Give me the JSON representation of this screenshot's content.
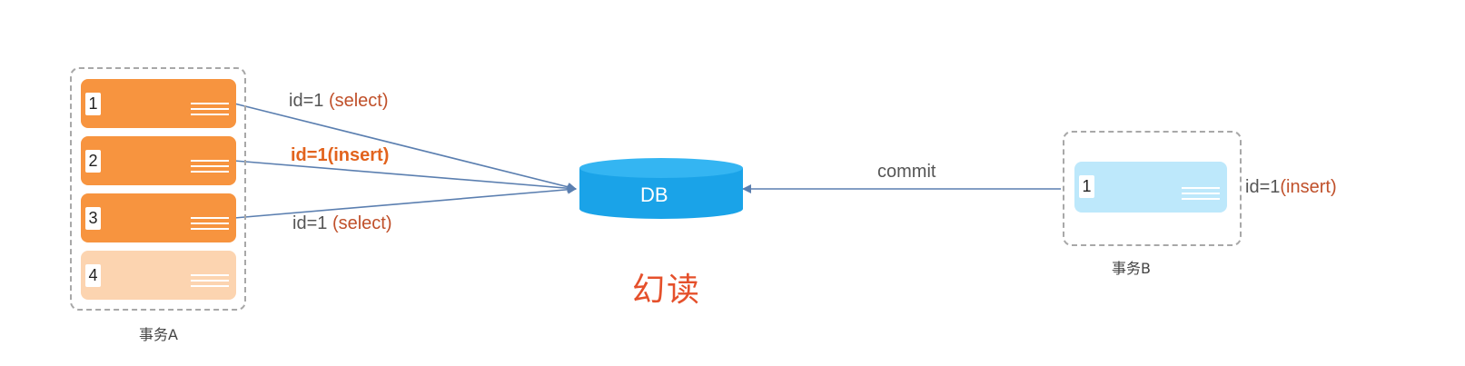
{
  "transaction_a": {
    "label": "事务A",
    "rows": [
      {
        "number": "1",
        "state": "normal"
      },
      {
        "number": "2",
        "state": "normal"
      },
      {
        "number": "3",
        "state": "normal"
      },
      {
        "number": "4",
        "state": "faded"
      }
    ]
  },
  "transaction_b": {
    "label": "事务B",
    "rows": [
      {
        "number": "1",
        "state": "normal"
      }
    ]
  },
  "edges": {
    "row1": {
      "key": "id=1 ",
      "op": "(select)"
    },
    "row2": {
      "key": "id=1",
      "op": "(insert)"
    },
    "row3": {
      "key": "id=1 ",
      "op": "(select)"
    },
    "commit": "commit"
  },
  "side_label": {
    "key": "id=1",
    "op": "(insert)"
  },
  "database": {
    "label": "DB"
  },
  "caption": "幻读",
  "colors": {
    "row_orange": "#f7943f",
    "row_faded": "#fcd4b0",
    "row_blue": "#bde8fb",
    "db_blue": "#1aa3e8",
    "arrow": "#5b7fb0",
    "caption_red": "#e5502b",
    "op_red": "#c0502a",
    "op_orange": "#e2631d"
  }
}
